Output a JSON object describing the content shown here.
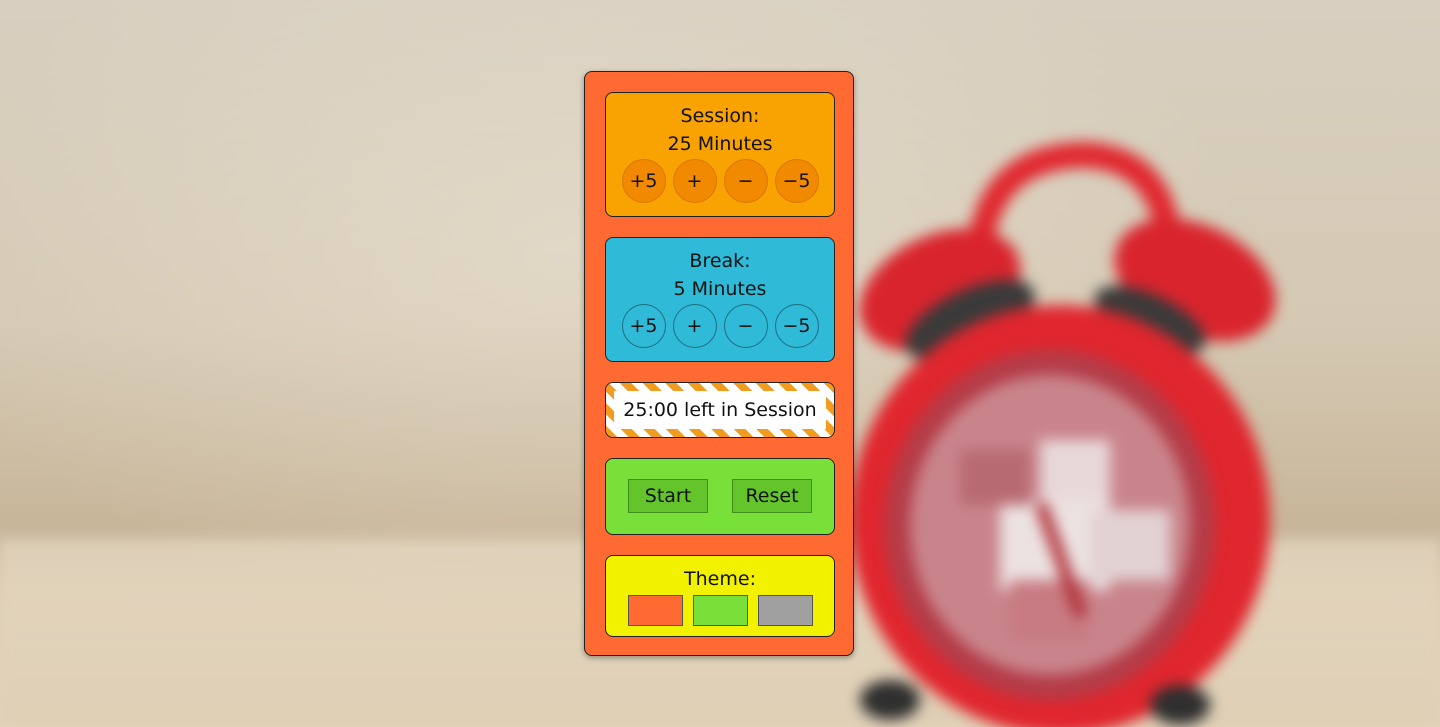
{
  "session": {
    "title": "Session:",
    "value": "25 Minutes",
    "buttons": [
      "+5",
      "+",
      "−",
      "−5"
    ],
    "color": "#f9a302"
  },
  "break": {
    "title": "Break:",
    "value": "5 Minutes",
    "buttons": [
      "+5",
      "+",
      "−",
      "−5"
    ],
    "color": "#2fbad8"
  },
  "status": {
    "text": "25:00 left in Session",
    "stripe_color": "#f29c1f"
  },
  "controls": {
    "start_label": "Start",
    "reset_label": "Reset",
    "color": "#79e03a"
  },
  "theme": {
    "title": "Theme:",
    "swatches": [
      {
        "name": "orange",
        "color": "#ff6a33"
      },
      {
        "name": "green",
        "color": "#79e03a"
      },
      {
        "name": "gray",
        "color": "#a0a0a0"
      }
    ],
    "color": "#f2f200"
  },
  "app": {
    "background": "#ff6a33"
  }
}
